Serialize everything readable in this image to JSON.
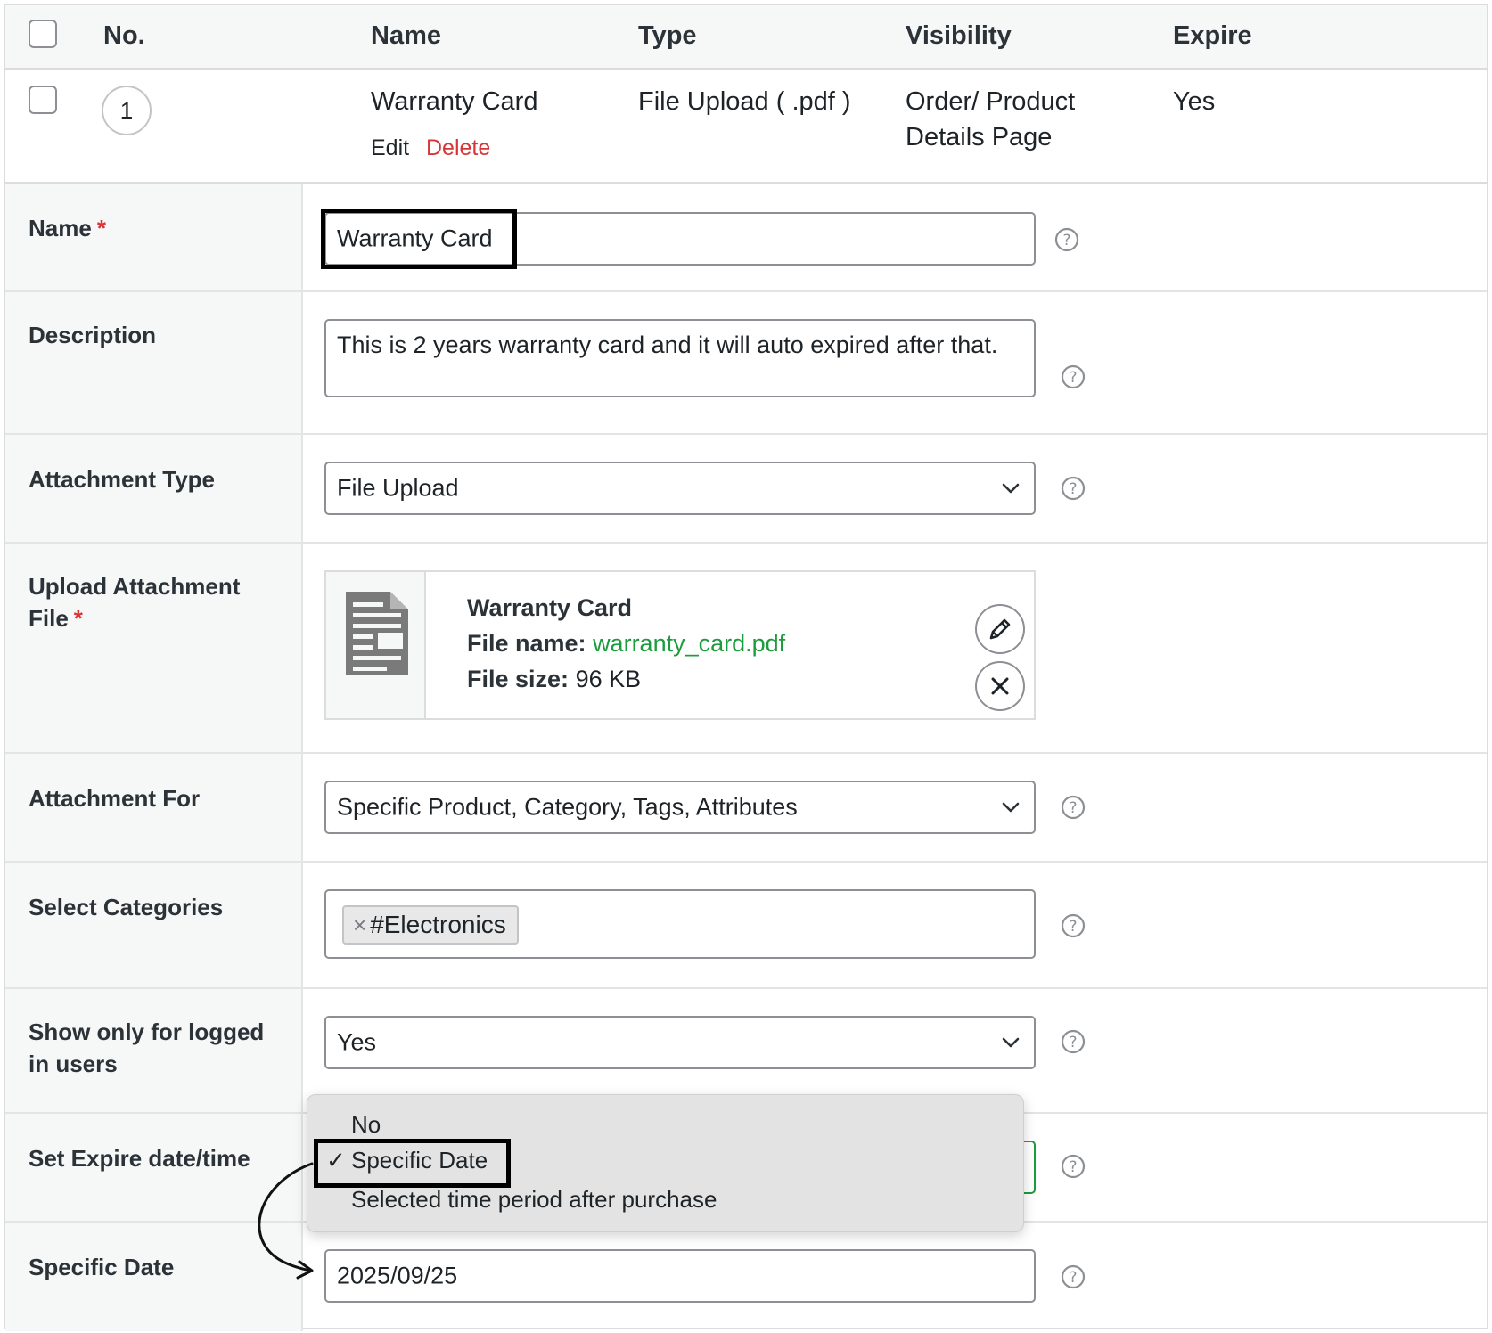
{
  "table": {
    "headers": {
      "no": "No.",
      "name": "Name",
      "type": "Type",
      "visibility": "Visibility",
      "expire": "Expire"
    },
    "rows": [
      {
        "no": "1",
        "name": "Warranty Card",
        "type": "File Upload ( .pdf )",
        "visibility_line1": "Order/ Product",
        "visibility_line2": "Details Page",
        "expire": "Yes",
        "edit_label": "Edit",
        "delete_label": "Delete"
      }
    ]
  },
  "form": {
    "name": {
      "label": "Name",
      "required_mark": "*",
      "value": "Warranty Card"
    },
    "description": {
      "label": "Description",
      "value": "This is 2 years warranty card and it will auto expired after that."
    },
    "attachment_type": {
      "label": "Attachment Type",
      "value": "File Upload"
    },
    "upload_file": {
      "label": "Upload Attachment File",
      "required_mark": "*",
      "title": "Warranty Card",
      "file_name_label": "File name:",
      "file_name": "warranty_card.pdf",
      "file_size_label": "File size:",
      "file_size": "96 KB"
    },
    "attachment_for": {
      "label": "Attachment For",
      "value": "Specific Product, Category, Tags, Attributes"
    },
    "select_categories": {
      "label": "Select Categories",
      "tag_remove": "×",
      "tags": [
        "#Electronics"
      ]
    },
    "logged_in_only": {
      "label": "Show only for logged in users",
      "value": "Yes"
    },
    "expire_datetime": {
      "label": "Set Expire date/time",
      "check_mark": "✓",
      "options": [
        "No",
        "Specific Date",
        "Selected time period after purchase"
      ],
      "selected": "Specific Date"
    },
    "specific_date": {
      "label": "Specific Date",
      "value": "2025/09/25"
    }
  },
  "icons": {
    "help": "question-circle-icon",
    "chevron": "chevron-down-icon",
    "document": "document-icon",
    "edit": "pencil-icon",
    "remove": "close-icon"
  },
  "colors": {
    "required": "#d63638",
    "delete": "#d63638",
    "file_link": "#1c9c3c",
    "active_border": "#1c9c3c"
  }
}
